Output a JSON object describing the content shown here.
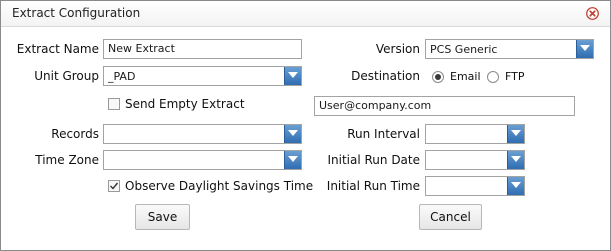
{
  "dialog": {
    "title": "Extract Configuration",
    "close_icon": "close-icon"
  },
  "fields": {
    "extract_name_label": "Extract Name",
    "extract_name_value": "New Extract",
    "unit_group_label": "Unit Group",
    "unit_group_value": "_PAD",
    "send_empty_extract_label": "Send Empty Extract",
    "send_empty_extract_checked": false,
    "records_label": "Records",
    "records_value": "",
    "time_zone_label": "Time Zone",
    "time_zone_value": "",
    "observe_dst_label": "Observe Daylight Savings Time",
    "observe_dst_checked": true,
    "version_label": "Version",
    "version_value": "PCS Generic",
    "destination_label": "Destination",
    "destination_options": [
      "Email",
      "FTP"
    ],
    "destination_selected": "Email",
    "destination_address": "User@company.com",
    "run_interval_label": "Run Interval",
    "run_interval_value": "",
    "initial_run_date_label": "Initial Run Date",
    "initial_run_date_value": "",
    "initial_run_time_label": "Initial Run Time",
    "initial_run_time_value": ""
  },
  "buttons": {
    "save": "Save",
    "cancel": "Cancel"
  },
  "colors": {
    "dropdown_arrow_top": "#6a9fd3",
    "dropdown_arrow_bottom": "#2f6db1",
    "close_icon": "#c0392b"
  }
}
